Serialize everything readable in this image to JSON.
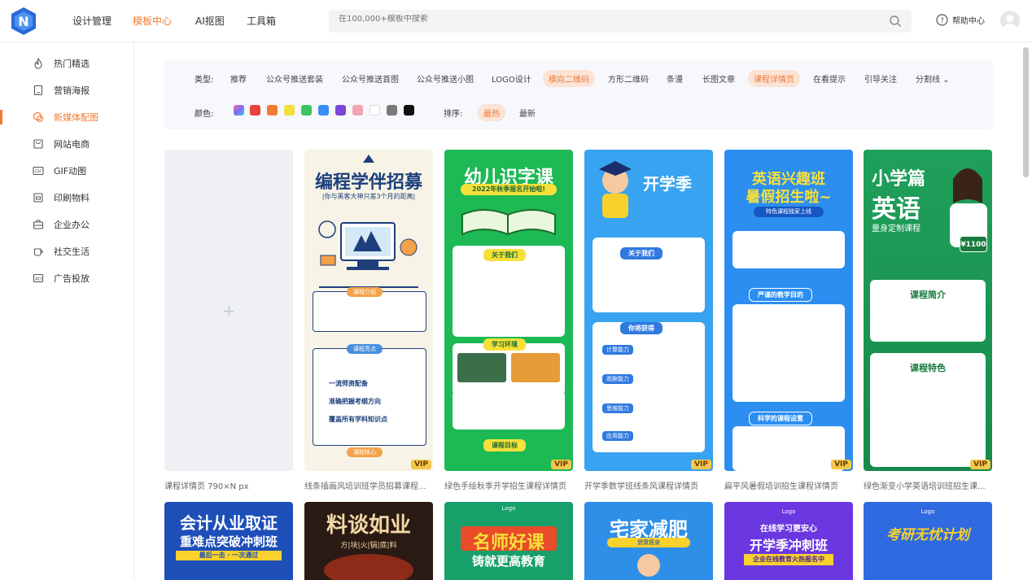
{
  "header": {
    "nav": [
      "设计管理",
      "模板中心",
      "AI抠图",
      "工具箱"
    ],
    "search_placeholder": "在100,000+模板中搜索",
    "help_label": "帮助中心"
  },
  "sidebar": {
    "items": [
      "热门精选",
      "营销海报",
      "新媒体配图",
      "网站电商",
      "GIF动图",
      "印刷物料",
      "企业办公",
      "社交生活",
      "广告投放"
    ]
  },
  "filters": {
    "type_label": "类型:",
    "types": [
      "推荐",
      "公众号推送套装",
      "公众号推送首图",
      "公众号推送小图",
      "LOGO设计",
      "横向二维码",
      "方形二维码",
      "条漫",
      "长图文章",
      "课程详情页",
      "在看提示",
      "引导关注",
      "分割线"
    ],
    "color_label": "颜色:",
    "colors": [
      "#7b6cf6",
      "#e8403a",
      "#f47a33",
      "#f5dd3c",
      "#40c463",
      "#3a8ef2",
      "#7c47d8",
      "#f1a4b0",
      "#ffffff",
      "#7a7a7a",
      "#111111"
    ],
    "sort_label": "排序:",
    "sort": [
      "最热",
      "最新"
    ]
  },
  "cards": [
    {
      "title": "课程详情页 790×N px",
      "vip": ""
    },
    {
      "title": "线条插画风培训班学员招募课程...",
      "vip": "VIP",
      "heading": "编程学伴招募",
      "sub": "|你与黑客大神只差3个月的距离|",
      "s1": "课程介绍",
      "s2": "课程亮点",
      "s3": "课程核心",
      "b1": "一流师资配备",
      "b2": "准确把握考纲方向",
      "b3": "覆盖所有学科知识点"
    },
    {
      "title": "绿色手绘秋季开学招生课程详情页",
      "vip": "VIP",
      "heading": "幼儿识字课",
      "sub": "2022年秋季报名开始啦!",
      "s1": "关于我们",
      "s2": "学习环境",
      "s3": "课程目标"
    },
    {
      "title": "开学季数学班线条风课程详情页",
      "vip": "VIP",
      "heading": "开学季",
      "s1": "关于我们",
      "s2": "你将获得",
      "b1": "计算能力",
      "b2": "观察能力",
      "b3": "思维能力",
      "b4": "应用能力"
    },
    {
      "title": "扁平风暑假培训招生课程详情页",
      "vip": "VIP",
      "heading": "英语兴趣班",
      "heading2": "暑假招生啦~",
      "sub": "特色课程独家上线",
      "s1": "严谨的教学目的",
      "s2": "科学的课程设置"
    },
    {
      "title": "绿色渐变小学英语培训班招生课...",
      "vip": "VIP",
      "heading": "小学篇",
      "heading2": "英语",
      "sub": "量身定制课程",
      "price": "¥1100",
      "s1": "课程简介",
      "s2": "课程特色"
    }
  ],
  "cards_row2": [
    {
      "heading": "会计从业取证",
      "sub": "重难点突破冲刺班",
      "tag": "最后一击 · 一次通过"
    },
    {
      "heading": "料谈如业",
      "sub": "方|块|火|锅|底|料"
    },
    {
      "logo": "Logo",
      "heading": "名师好课",
      "sub": "铸就更高教育"
    },
    {
      "heading": "宅家减肥",
      "sub": "健康瘦身"
    },
    {
      "logo": "Logo",
      "quote": "在线学习更安心",
      "heading": "开学季冲刺班",
      "sub": "企业在线教育火热报名中"
    },
    {
      "logo": "Logo",
      "heading": "考研无忧计划"
    }
  ]
}
